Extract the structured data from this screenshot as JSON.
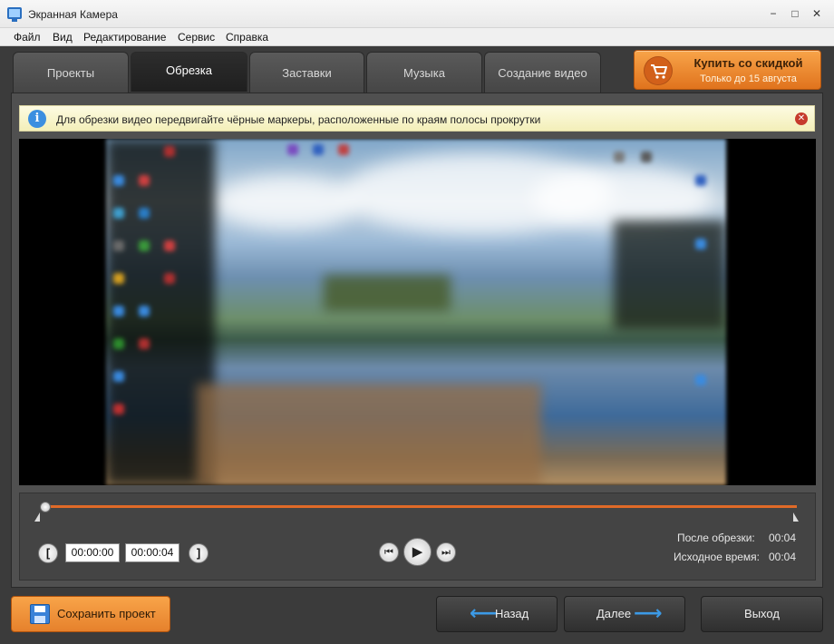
{
  "window": {
    "title": "Экранная Камера",
    "minimize": "−",
    "maximize": "□",
    "close": "✕"
  },
  "menu": [
    "Файл",
    "Вид",
    "Редактирование",
    "Сервис",
    "Справка"
  ],
  "tabs": [
    {
      "label": "Проекты",
      "active": false
    },
    {
      "label": "Обрезка",
      "active": true
    },
    {
      "label": "Заставки",
      "active": false
    },
    {
      "label": "Музыка",
      "active": false
    },
    {
      "label": "Создание видео",
      "active": false
    }
  ],
  "promo": {
    "title": "Купить со скидкой",
    "subtitle": "Только до 15 августа",
    "icon": "shopping-cart-icon"
  },
  "info": {
    "icon_text": "i",
    "message": "Для обрезки видео передвигайте чёрные маркеры, расположенные по краям полосы прокрутки",
    "close": "✕"
  },
  "trim": {
    "start_bracket": "[",
    "end_bracket": "]",
    "start_time": "00:00:00",
    "end_time": "00:00:04",
    "after_trim_label": "После обрезки:",
    "after_trim_value": "00:04",
    "original_label": "Исходное время:",
    "original_value": "00:04",
    "position_fraction": 0.0
  },
  "playback": {
    "prev": "⏮",
    "play": "▶",
    "next": "⏭"
  },
  "footer": {
    "save": "Сохранить проект",
    "back": "Назад",
    "next": "Далее",
    "exit": "Выход"
  },
  "colors": {
    "accent_orange": "#e06a28",
    "info_blue": "#3c8fe0",
    "arrow_blue": "#3c9ae6"
  }
}
